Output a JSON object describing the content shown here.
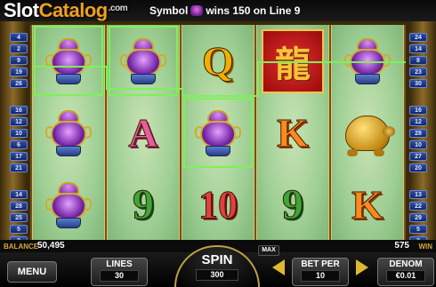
{
  "watermark": {
    "part1": "Slot",
    "part2": "Catalog",
    "part3": ".com"
  },
  "win_message": {
    "prefix": "Symbol",
    "suffix": "wins 150 on Line 9"
  },
  "left_lines": [
    "4",
    "2",
    "9",
    "19",
    "26",
    "16",
    "12",
    "10",
    "6",
    "17",
    "21",
    "14",
    "28",
    "25",
    "5",
    "3"
  ],
  "right_lines": [
    "24",
    "14",
    "8",
    "23",
    "30",
    "16",
    "12",
    "28",
    "10",
    "27",
    "20",
    "13",
    "22",
    "29",
    "5",
    "3"
  ],
  "reels": [
    [
      "pot",
      "pot",
      "pot"
    ],
    [
      "pot",
      "A",
      "9"
    ],
    [
      "Q",
      "pot",
      "10"
    ],
    [
      "wild",
      "K",
      "9"
    ],
    [
      "pot",
      "turtle",
      "K"
    ]
  ],
  "wild_glyph": "龍",
  "balance": {
    "label": "BALANCE",
    "value": "50,495"
  },
  "win": {
    "label": "WIN",
    "value": "575"
  },
  "max_label": "MAX",
  "menu_label": "MENU",
  "lines": {
    "label": "LINES",
    "value": "30"
  },
  "spin": {
    "label": "SPIN",
    "value": "300"
  },
  "bet_per": {
    "label": "BET PER",
    "value": "10"
  },
  "denom": {
    "label": "DENOM",
    "value": "€0.01"
  },
  "colors": {
    "payline": "#7ef05a",
    "frame_gold": "#bba145"
  }
}
